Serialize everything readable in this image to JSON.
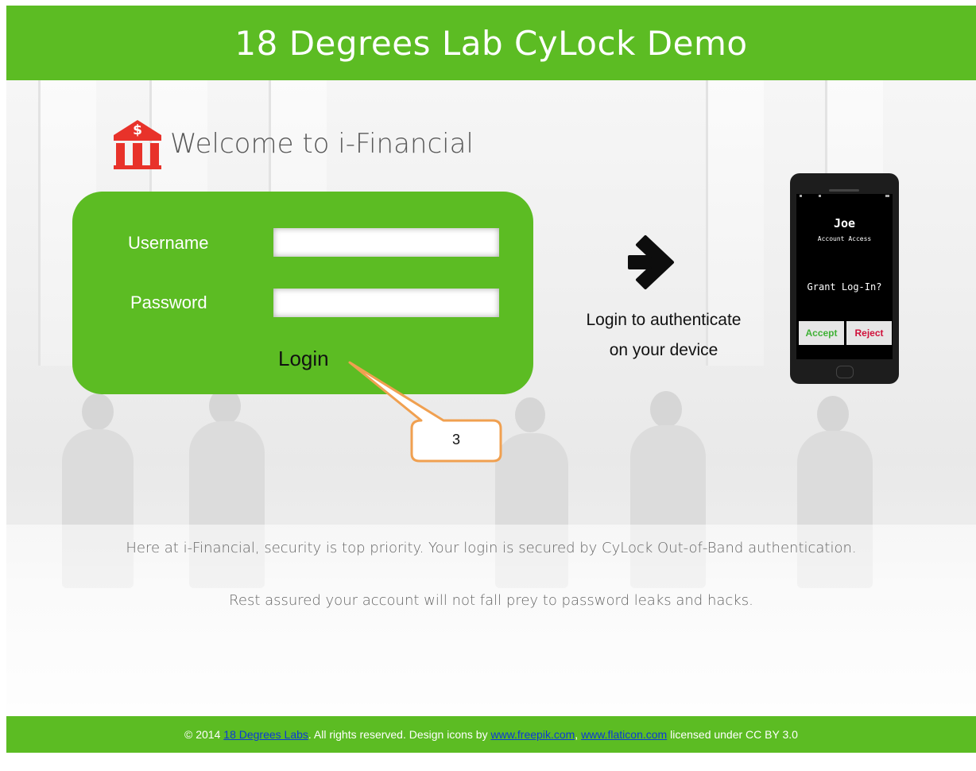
{
  "header": {
    "title": "18 Degrees Lab CyLock Demo"
  },
  "welcome": {
    "text": "Welcome to i-Financial",
    "icon": "bank-icon"
  },
  "login_form": {
    "username_label": "Username",
    "username_value": "",
    "password_label": "Password",
    "password_value": "",
    "login_label": "Login"
  },
  "callout": {
    "number": "3"
  },
  "flow": {
    "icon": "arrow-right-icon",
    "caption_line1": "Login to authenticate",
    "caption_line2": "on your device"
  },
  "phone": {
    "user": "Joe",
    "subtitle": "Account Access",
    "prompt": "Grant Log-In?",
    "accept_label": "Accept",
    "reject_label": "Reject"
  },
  "info": {
    "line1": "Here at i-Financial, security is top priority. Your login is secured by CyLock Out-of-Band authentication.",
    "line2": "Rest assured your account will not fall prey to password leaks and hacks."
  },
  "footer": {
    "prefix": "© 2014 ",
    "company_link": "18 Degrees Labs",
    "mid": ". All rights reserved. Design icons by ",
    "link1": "www.freepik.com",
    "sep": ", ",
    "link2": "www.flaticon.com",
    "suffix": " licensed under CC BY 3.0"
  },
  "colors": {
    "brand_green": "#5cbc23",
    "bank_red": "#e8322a",
    "accept_green": "#3fb135",
    "reject_red": "#d0103a",
    "link_blue": "#0b39d6"
  }
}
